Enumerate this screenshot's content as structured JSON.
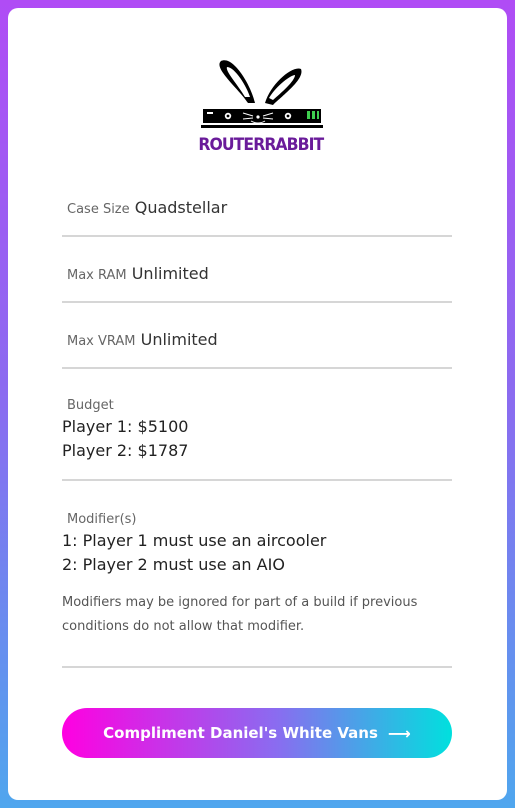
{
  "logo": {
    "brand_text": "ROUTERRABBIT"
  },
  "fields": {
    "case_size": {
      "label": "Case Size",
      "value": "Quadstellar"
    },
    "max_ram": {
      "label": "Max RAM",
      "value": "Unlimited"
    },
    "max_vram": {
      "label": "Max VRAM",
      "value": "Unlimited"
    },
    "budget": {
      "label": "Budget",
      "lines": [
        "Player 1: $5100",
        "Player 2: $1787"
      ]
    },
    "modifiers": {
      "label": "Modifier(s)",
      "lines": [
        "1: Player 1 must use an aircooler",
        "2: Player 2 must use an AIO"
      ],
      "note_lines": [
        "Modifiers may be ignored for part of a build if previous",
        "conditions do not allow that modifier."
      ]
    }
  },
  "button": {
    "label": "Compliment Daniel's White Vans",
    "icon": "arrow-right-icon"
  },
  "colors": {
    "brand": "#6a1b9a",
    "button_gradient_start": "#ff00e1",
    "button_gradient_end": "#00e0de"
  }
}
